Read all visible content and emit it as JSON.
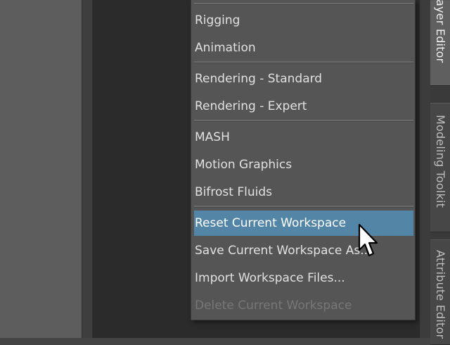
{
  "menu": {
    "groups": [
      {
        "items": [
          {
            "label": "Rigging"
          },
          {
            "label": "Animation"
          }
        ]
      },
      {
        "items": [
          {
            "label": "Rendering - Standard"
          },
          {
            "label": "Rendering - Expert"
          }
        ]
      },
      {
        "items": [
          {
            "label": "MASH"
          },
          {
            "label": "Motion Graphics"
          },
          {
            "label": "Bifrost Fluids"
          }
        ]
      },
      {
        "items": [
          {
            "label": "Reset Current Workspace",
            "state": "highlighted"
          },
          {
            "label": "Save Current Workspace As..."
          },
          {
            "label": "Import Workspace Files..."
          },
          {
            "label": "Delete Current Workspace",
            "state": "disabled"
          }
        ]
      }
    ]
  },
  "side_tabs": [
    {
      "label": "/ Layer Editor",
      "active": true
    },
    {
      "label": "Modeling Toolkit",
      "active": false
    },
    {
      "label": "Attribute Editor",
      "active": false
    }
  ],
  "colors": {
    "menu_bg": "#555555",
    "highlight": "#5285a6",
    "text": "#e1e1e1",
    "disabled_text": "#777777",
    "viewport_bg": "#2b2b2b"
  },
  "cursor": {
    "icon": "arrow-cursor-icon"
  }
}
